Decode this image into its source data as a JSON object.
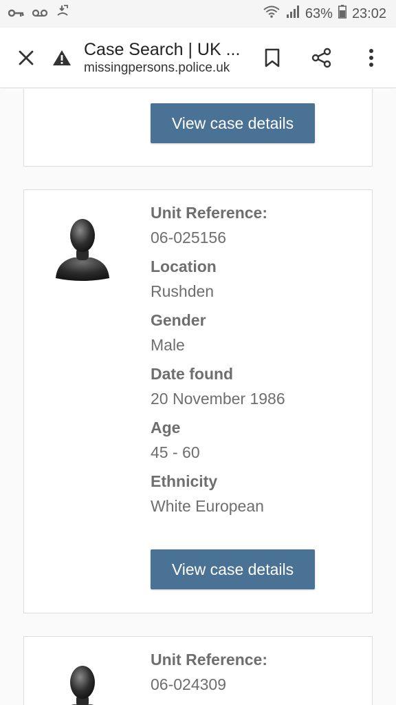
{
  "status": {
    "battery": "63%",
    "time": "23:02"
  },
  "browser": {
    "title": "Case Search | UK ...",
    "url": "missingpersons.police.uk"
  },
  "button_label": "View case details",
  "cards": [
    {
      "fields": []
    },
    {
      "fields": [
        {
          "label": "Unit Reference:",
          "value": "06-025156"
        },
        {
          "label": "Location",
          "value": "Rushden"
        },
        {
          "label": "Gender",
          "value": "Male"
        },
        {
          "label": "Date found",
          "value": "20 November 1986"
        },
        {
          "label": "Age",
          "value": "45 - 60"
        },
        {
          "label": "Ethnicity",
          "value": "White European"
        }
      ]
    },
    {
      "fields": [
        {
          "label": "Unit Reference:",
          "value": "06-024309"
        }
      ]
    }
  ],
  "colors": {
    "button": "#4a7294",
    "text": "#6e6e6e"
  },
  "icons": [
    "key-icon",
    "voicemail-icon",
    "call-forward-icon",
    "wifi-icon",
    "signal-icon",
    "battery-icon",
    "close-icon",
    "warning-icon",
    "bookmark-icon",
    "share-icon",
    "more-icon",
    "person-silhouette-icon"
  ]
}
